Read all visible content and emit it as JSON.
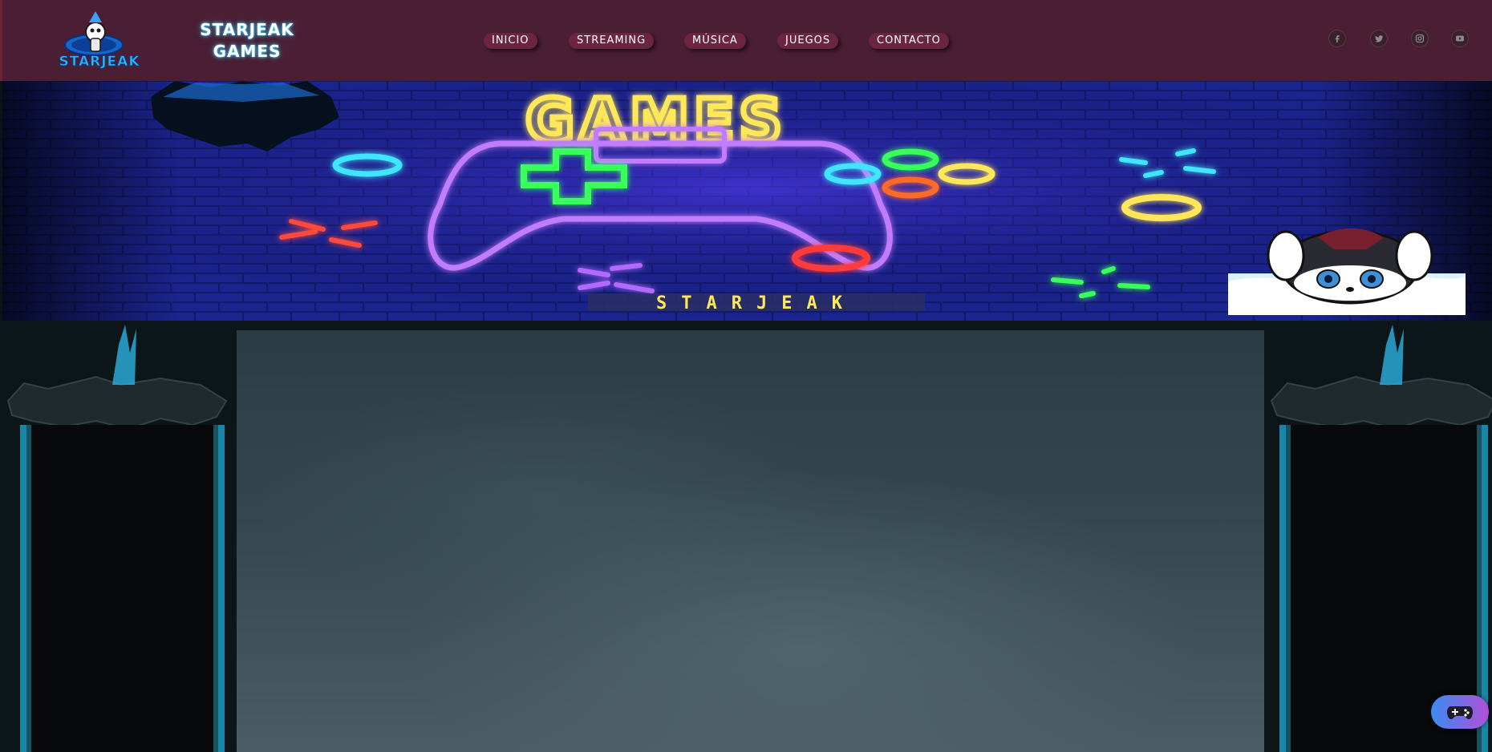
{
  "header": {
    "logo_text": "STARJEAK",
    "brand_line1": "STARJEAK",
    "brand_line2": "GAMES",
    "nav": [
      {
        "label": "INICIO"
      },
      {
        "label": "STREAMING"
      },
      {
        "label": "MÚSICA"
      },
      {
        "label": "JUEGOS"
      },
      {
        "label": "CONTACTO"
      }
    ],
    "social": [
      {
        "icon": "facebook-icon"
      },
      {
        "icon": "twitter-icon"
      },
      {
        "icon": "instagram-icon"
      },
      {
        "icon": "youtube-icon"
      }
    ]
  },
  "banner": {
    "headline": "GAMES",
    "signature": "STARJEAK"
  },
  "floating_button": {
    "icon": "gamepad-icon"
  },
  "colors": {
    "header_bg": "#4a1f33",
    "nav_pill": "#6b2540",
    "brand_glow": "#3ad3ff",
    "banner_bg": "#0a0f4a",
    "neon_yellow": "#ffe75a",
    "neon_purple": "#c27bff",
    "neon_green": "#39ff5a",
    "neon_cyan": "#40e6ff",
    "neon_red": "#ff3b3b"
  }
}
